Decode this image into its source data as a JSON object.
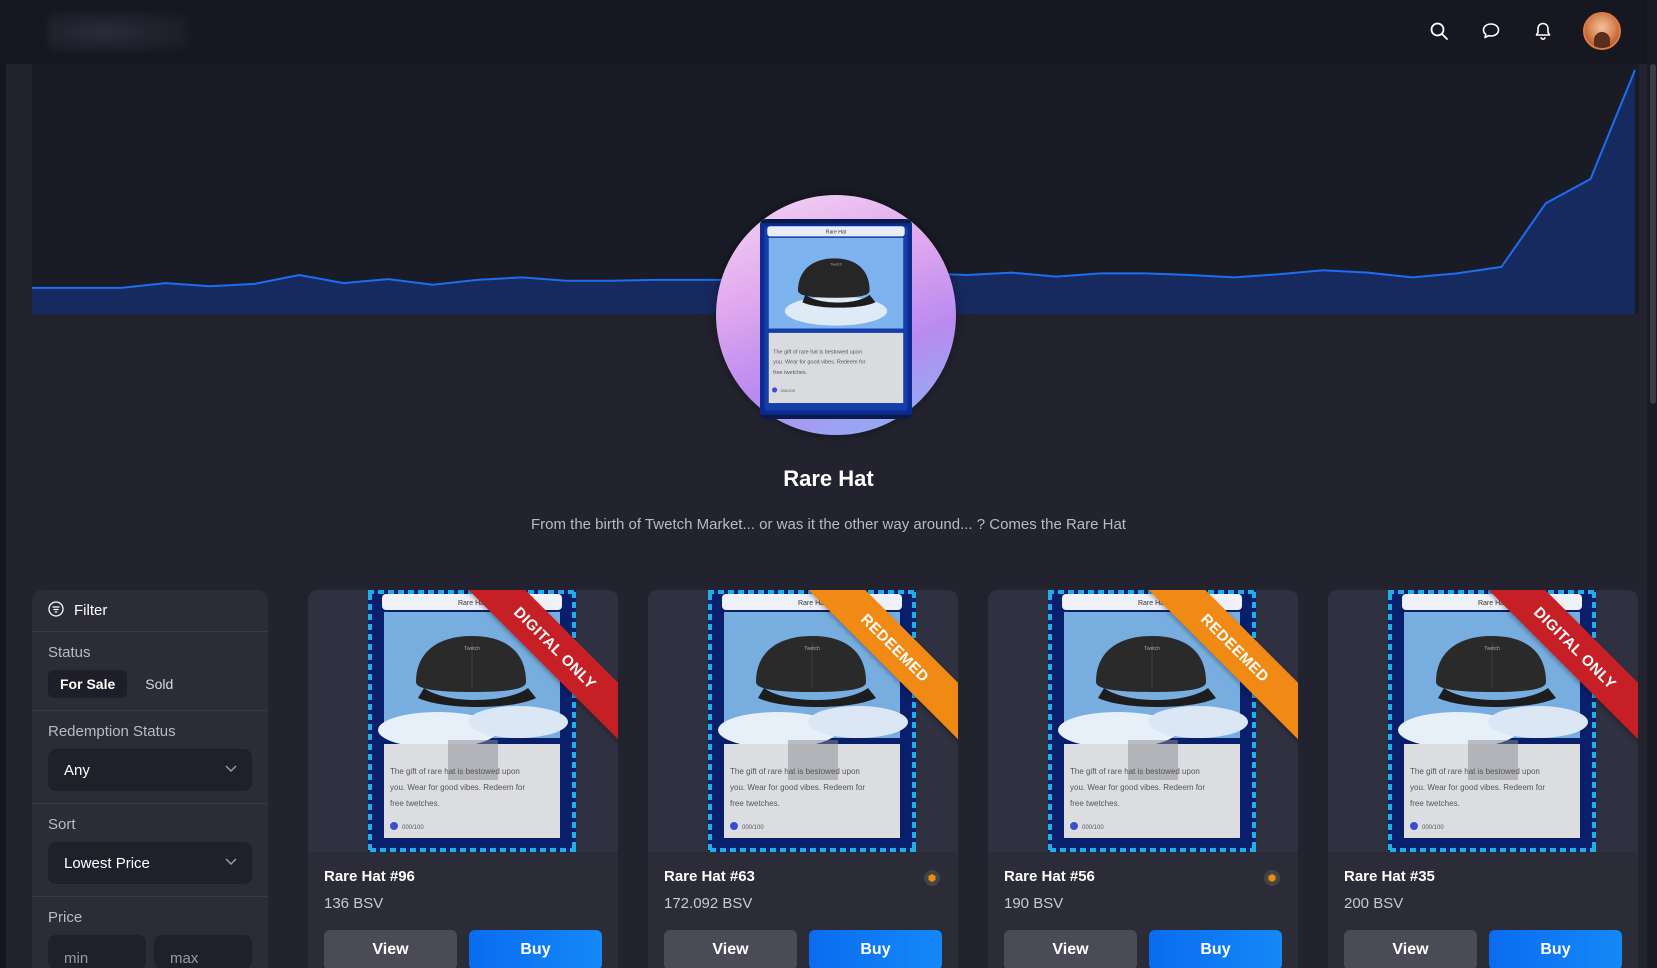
{
  "header": {
    "icons": [
      "search-icon",
      "chat-icon",
      "bell-icon"
    ],
    "avatar": "user-avatar"
  },
  "collection": {
    "title": "Rare Hat",
    "description": "From the birth of Twetch Market... or was it the other way around... ? Comes the Rare Hat"
  },
  "filter": {
    "heading": "Filter",
    "status_label": "Status",
    "status_options": [
      "For Sale",
      "Sold"
    ],
    "redemption_label": "Redemption Status",
    "redemption_value": "Any",
    "sort_label": "Sort",
    "sort_value": "Lowest Price",
    "price_label": "Price",
    "price_min_placeholder": "min",
    "price_max_placeholder": "max"
  },
  "cards": [
    {
      "name": "Rare Hat #96",
      "price": "136 BSV",
      "ribbon": "DIGITAL ONLY",
      "ribbon_type": "digital",
      "has_badge": false,
      "view_label": "View",
      "buy_label": "Buy"
    },
    {
      "name": "Rare Hat #63",
      "price": "172.092 BSV",
      "ribbon": "REDEEMED",
      "ribbon_type": "redeemed",
      "has_badge": true,
      "view_label": "View",
      "buy_label": "Buy"
    },
    {
      "name": "Rare Hat #56",
      "price": "190 BSV",
      "ribbon": "REDEEMED",
      "ribbon_type": "redeemed",
      "has_badge": true,
      "view_label": "View",
      "buy_label": "Buy"
    },
    {
      "name": "Rare Hat #35",
      "price": "200 BSV",
      "ribbon": "DIGITAL ONLY",
      "ribbon_type": "digital",
      "has_badge": false,
      "view_label": "View",
      "buy_label": "Buy"
    }
  ],
  "nft_art": {
    "header": "Rare Hat",
    "brand": "Twetch",
    "flavor_text": "The gift of rare hat is bestowed upon you. Wear for good vibes. Redeem for free twetches.",
    "serial": "000/100"
  },
  "chart_data": {
    "type": "area",
    "title": "",
    "xlabel": "",
    "ylabel": "",
    "values": [
      1,
      1,
      1,
      1.6,
      1.2,
      1.5,
      2.6,
      1.6,
      2.1,
      1.4,
      2,
      2.3,
      1.9,
      1.9,
      2,
      2,
      2,
      2.2,
      2.5,
      2.3,
      2.8,
      2.6,
      2.9,
      2.4,
      2.8,
      2.8,
      2.6,
      2.3,
      2.7,
      3.2,
      2.9,
      2.3,
      2.8,
      3.6,
      11.5,
      14.5,
      28
    ],
    "colors": {
      "line": "#1e6cf0",
      "fill": "#172a60"
    }
  },
  "colors": {
    "accent": "#0a6cf0",
    "digital_ribbon": "#c62026",
    "redeemed_ribbon": "#f08a14",
    "background": "#23232f",
    "panel": "#2b2c38"
  }
}
